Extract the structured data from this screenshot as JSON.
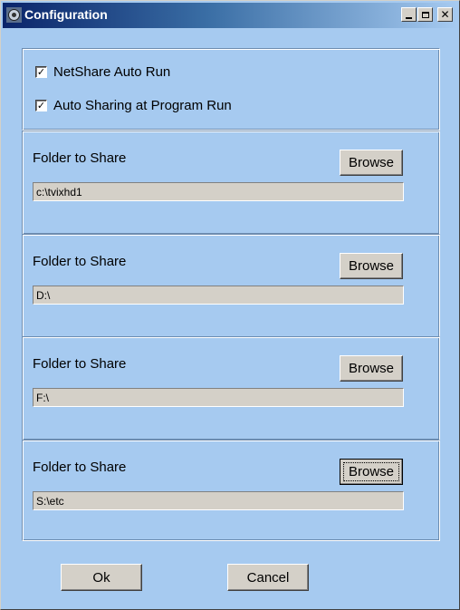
{
  "window": {
    "title": "Configuration",
    "icon": "app-icon",
    "controls": {
      "minimize": "_",
      "maximize": "□",
      "close": "×"
    }
  },
  "options": [
    {
      "label": "NetShare  Auto Run",
      "checked": true
    },
    {
      "label": "Auto Sharing at Program Run",
      "checked": true
    }
  ],
  "folders": [
    {
      "label": "Folder to Share",
      "button": "Browse",
      "path": "c:\\tvixhd1"
    },
    {
      "label": "Folder to Share",
      "button": "Browse",
      "path": "D:\\"
    },
    {
      "label": "Folder to Share",
      "button": "Browse",
      "path": "F:\\"
    },
    {
      "label": "Folder to Share",
      "button": "Browse",
      "path": "S:\\etc"
    }
  ],
  "buttons": {
    "ok": "Ok",
    "cancel": "Cancel"
  },
  "colors": {
    "background": "#a6caf0",
    "titlebar": "#0a246a",
    "button_face": "#d4d0c8"
  }
}
